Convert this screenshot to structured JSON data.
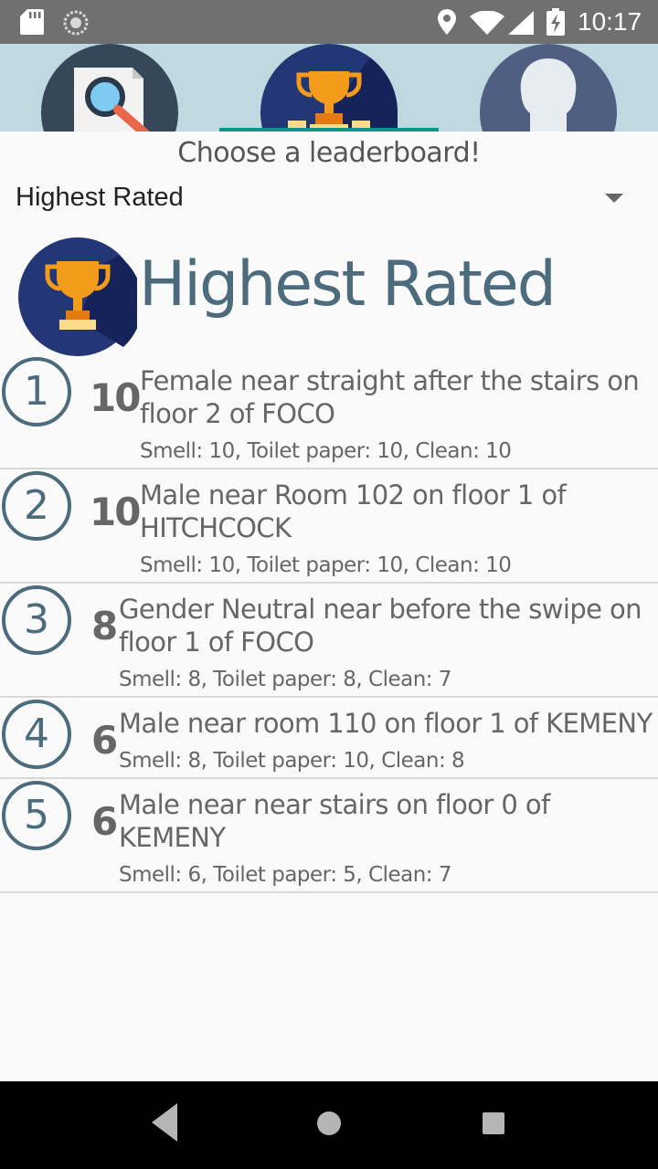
{
  "status_bar": {
    "time": "10:17",
    "icons": [
      "sd-card-icon",
      "sync-icon",
      "location-icon",
      "wifi-icon",
      "signal-icon",
      "battery-charging-icon"
    ]
  },
  "tabs": [
    {
      "icon": "search-document-icon",
      "selected": false
    },
    {
      "icon": "trophy-icon",
      "selected": true
    },
    {
      "icon": "profile-icon",
      "selected": false
    }
  ],
  "prompt": "Choose a leaderboard!",
  "selector": {
    "value": "Highest Rated"
  },
  "board": {
    "title": "Highest Rated",
    "icon": "trophy-icon"
  },
  "entries": [
    {
      "rank": "1",
      "score": "10",
      "location": "Female near straight after the stairs on floor 2 of FOCO",
      "details": "Smell: 10, Toilet paper: 10, Clean: 10"
    },
    {
      "rank": "2",
      "score": "10",
      "location": "Male near Room 102 on floor 1 of HITCHCOCK",
      "details": "Smell: 10, Toilet paper: 10, Clean: 10"
    },
    {
      "rank": "3",
      "score": "8",
      "location": "Gender Neutral near before the swipe on floor 1 of FOCO",
      "details": "Smell: 8, Toilet paper: 8, Clean: 7"
    },
    {
      "rank": "4",
      "score": "6",
      "location": "Male near room 110 on floor 1 of KEMENY",
      "details": "Smell: 8, Toilet paper: 10, Clean: 8"
    },
    {
      "rank": "5",
      "score": "6",
      "location": "Male near near stairs on floor 0 of KEMENY",
      "details": "Smell: 6, Toilet paper: 5, Clean: 7"
    }
  ],
  "colors": {
    "status_bar": "#707070",
    "tab_bar": "#c0d8e0",
    "tab_indicator": "#11938d",
    "title": "#4c6b7c",
    "text": "#666666"
  },
  "nav_bar": {
    "icons": [
      "back-icon",
      "home-icon",
      "recents-icon"
    ]
  }
}
